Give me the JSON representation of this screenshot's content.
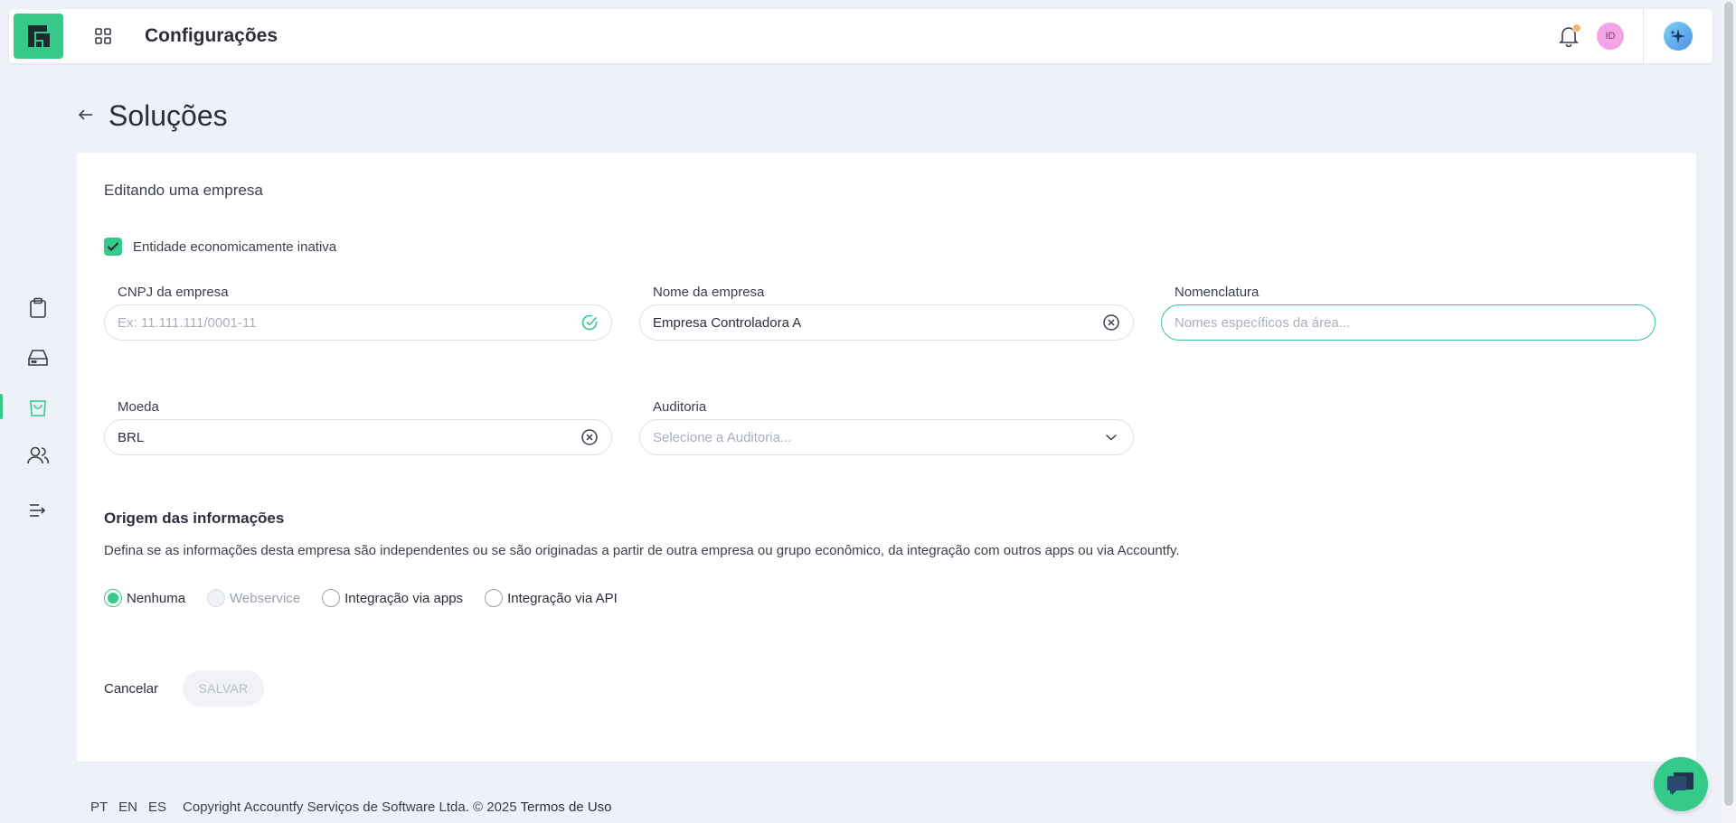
{
  "header": {
    "title": "Configurações",
    "avatar_initials": "ID"
  },
  "sidebar": {
    "items": [
      {
        "name": "clipboard-icon"
      },
      {
        "name": "drive-icon"
      },
      {
        "name": "shopping-bag-icon",
        "active": true
      },
      {
        "name": "users-icon"
      },
      {
        "name": "expand-menu-icon"
      }
    ]
  },
  "page": {
    "title": "Soluções"
  },
  "form": {
    "heading": "Editando uma empresa",
    "inactive_checkbox": {
      "label": "Entidade economicamente inativa",
      "checked": true
    },
    "cnpj": {
      "label": "CNPJ da empresa",
      "value": "",
      "placeholder": "Ex: 11.111.111/0001-11"
    },
    "company_name": {
      "label": "Nome da empresa",
      "value": "Empresa Controladora A",
      "placeholder": ""
    },
    "nomenclature": {
      "label": "Nomenclatura",
      "value": "",
      "placeholder": "Nomes específicos da área..."
    },
    "currency": {
      "label": "Moeda",
      "value": "BRL",
      "placeholder": ""
    },
    "audit": {
      "label": "Auditoria",
      "value": "",
      "placeholder": "Selecione a Auditoria..."
    }
  },
  "origin": {
    "title": "Origem das informações",
    "description": "Defina se as informações desta empresa são independentes ou se são originadas a partir de outra empresa ou grupo econômico, da integração com outros apps ou via Accountfy.",
    "options": [
      {
        "label": "Nenhuma",
        "checked": true,
        "disabled": false
      },
      {
        "label": "Webservice",
        "checked": false,
        "disabled": true
      },
      {
        "label": "Integração via apps",
        "checked": false,
        "disabled": false
      },
      {
        "label": "Integração via API",
        "checked": false,
        "disabled": false
      }
    ]
  },
  "actions": {
    "cancel_label": "Cancelar",
    "save_label": "SALVAR"
  },
  "footer": {
    "languages": [
      "PT",
      "EN",
      "ES"
    ],
    "copyright": "Copyright Accountfy Serviços de Software Ltda. © 2025",
    "terms": "Termos de Uso"
  },
  "colors": {
    "accent": "#35c98a",
    "background": "#eef1f8"
  }
}
